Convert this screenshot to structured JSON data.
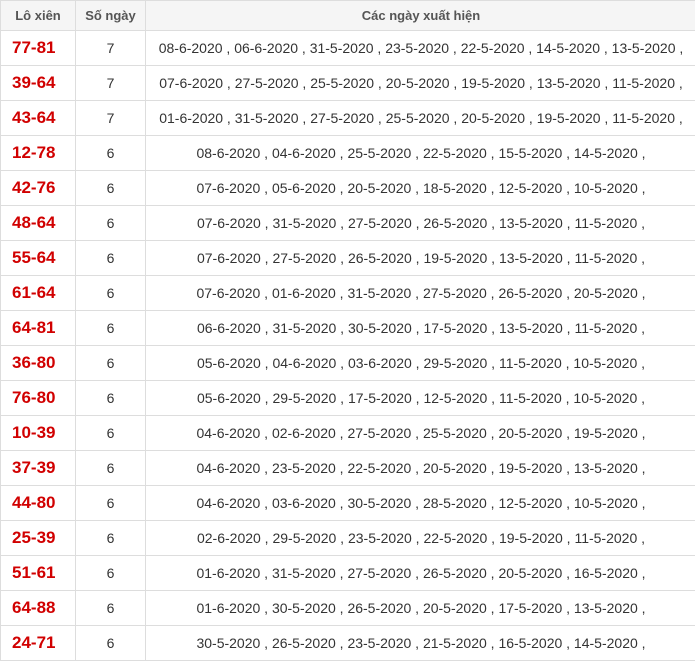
{
  "header": {
    "pair": "Lô xiên",
    "days": "Số ngày",
    "dates": "Các ngày xuất hiện"
  },
  "rows": [
    {
      "pair": "77-81",
      "days": "7",
      "dates": "08-6-2020 , 06-6-2020 , 31-5-2020 , 23-5-2020 , 22-5-2020 , 14-5-2020 , 13-5-2020 ,"
    },
    {
      "pair": "39-64",
      "days": "7",
      "dates": "07-6-2020 , 27-5-2020 , 25-5-2020 , 20-5-2020 , 19-5-2020 , 13-5-2020 , 11-5-2020 ,"
    },
    {
      "pair": "43-64",
      "days": "7",
      "dates": "01-6-2020 , 31-5-2020 , 27-5-2020 , 25-5-2020 , 20-5-2020 , 19-5-2020 , 11-5-2020 ,"
    },
    {
      "pair": "12-78",
      "days": "6",
      "dates": "08-6-2020 , 04-6-2020 , 25-5-2020 , 22-5-2020 , 15-5-2020 , 14-5-2020 ,"
    },
    {
      "pair": "42-76",
      "days": "6",
      "dates": "07-6-2020 , 05-6-2020 , 20-5-2020 , 18-5-2020 , 12-5-2020 , 10-5-2020 ,"
    },
    {
      "pair": "48-64",
      "days": "6",
      "dates": "07-6-2020 , 31-5-2020 , 27-5-2020 , 26-5-2020 , 13-5-2020 , 11-5-2020 ,"
    },
    {
      "pair": "55-64",
      "days": "6",
      "dates": "07-6-2020 , 27-5-2020 , 26-5-2020 , 19-5-2020 , 13-5-2020 , 11-5-2020 ,"
    },
    {
      "pair": "61-64",
      "days": "6",
      "dates": "07-6-2020 , 01-6-2020 , 31-5-2020 , 27-5-2020 , 26-5-2020 , 20-5-2020 ,"
    },
    {
      "pair": "64-81",
      "days": "6",
      "dates": "06-6-2020 , 31-5-2020 , 30-5-2020 , 17-5-2020 , 13-5-2020 , 11-5-2020 ,"
    },
    {
      "pair": "36-80",
      "days": "6",
      "dates": "05-6-2020 , 04-6-2020 , 03-6-2020 , 29-5-2020 , 11-5-2020 , 10-5-2020 ,"
    },
    {
      "pair": "76-80",
      "days": "6",
      "dates": "05-6-2020 , 29-5-2020 , 17-5-2020 , 12-5-2020 , 11-5-2020 , 10-5-2020 ,"
    },
    {
      "pair": "10-39",
      "days": "6",
      "dates": "04-6-2020 , 02-6-2020 , 27-5-2020 , 25-5-2020 , 20-5-2020 , 19-5-2020 ,"
    },
    {
      "pair": "37-39",
      "days": "6",
      "dates": "04-6-2020 , 23-5-2020 , 22-5-2020 , 20-5-2020 , 19-5-2020 , 13-5-2020 ,"
    },
    {
      "pair": "44-80",
      "days": "6",
      "dates": "04-6-2020 , 03-6-2020 , 30-5-2020 , 28-5-2020 , 12-5-2020 , 10-5-2020 ,"
    },
    {
      "pair": "25-39",
      "days": "6",
      "dates": "02-6-2020 , 29-5-2020 , 23-5-2020 , 22-5-2020 , 19-5-2020 , 11-5-2020 ,"
    },
    {
      "pair": "51-61",
      "days": "6",
      "dates": "01-6-2020 , 31-5-2020 , 27-5-2020 , 26-5-2020 , 20-5-2020 , 16-5-2020 ,"
    },
    {
      "pair": "64-88",
      "days": "6",
      "dates": "01-6-2020 , 30-5-2020 , 26-5-2020 , 20-5-2020 , 17-5-2020 , 13-5-2020 ,"
    },
    {
      "pair": "24-71",
      "days": "6",
      "dates": "30-5-2020 , 26-5-2020 , 23-5-2020 , 21-5-2020 , 16-5-2020 , 14-5-2020 ,"
    }
  ]
}
